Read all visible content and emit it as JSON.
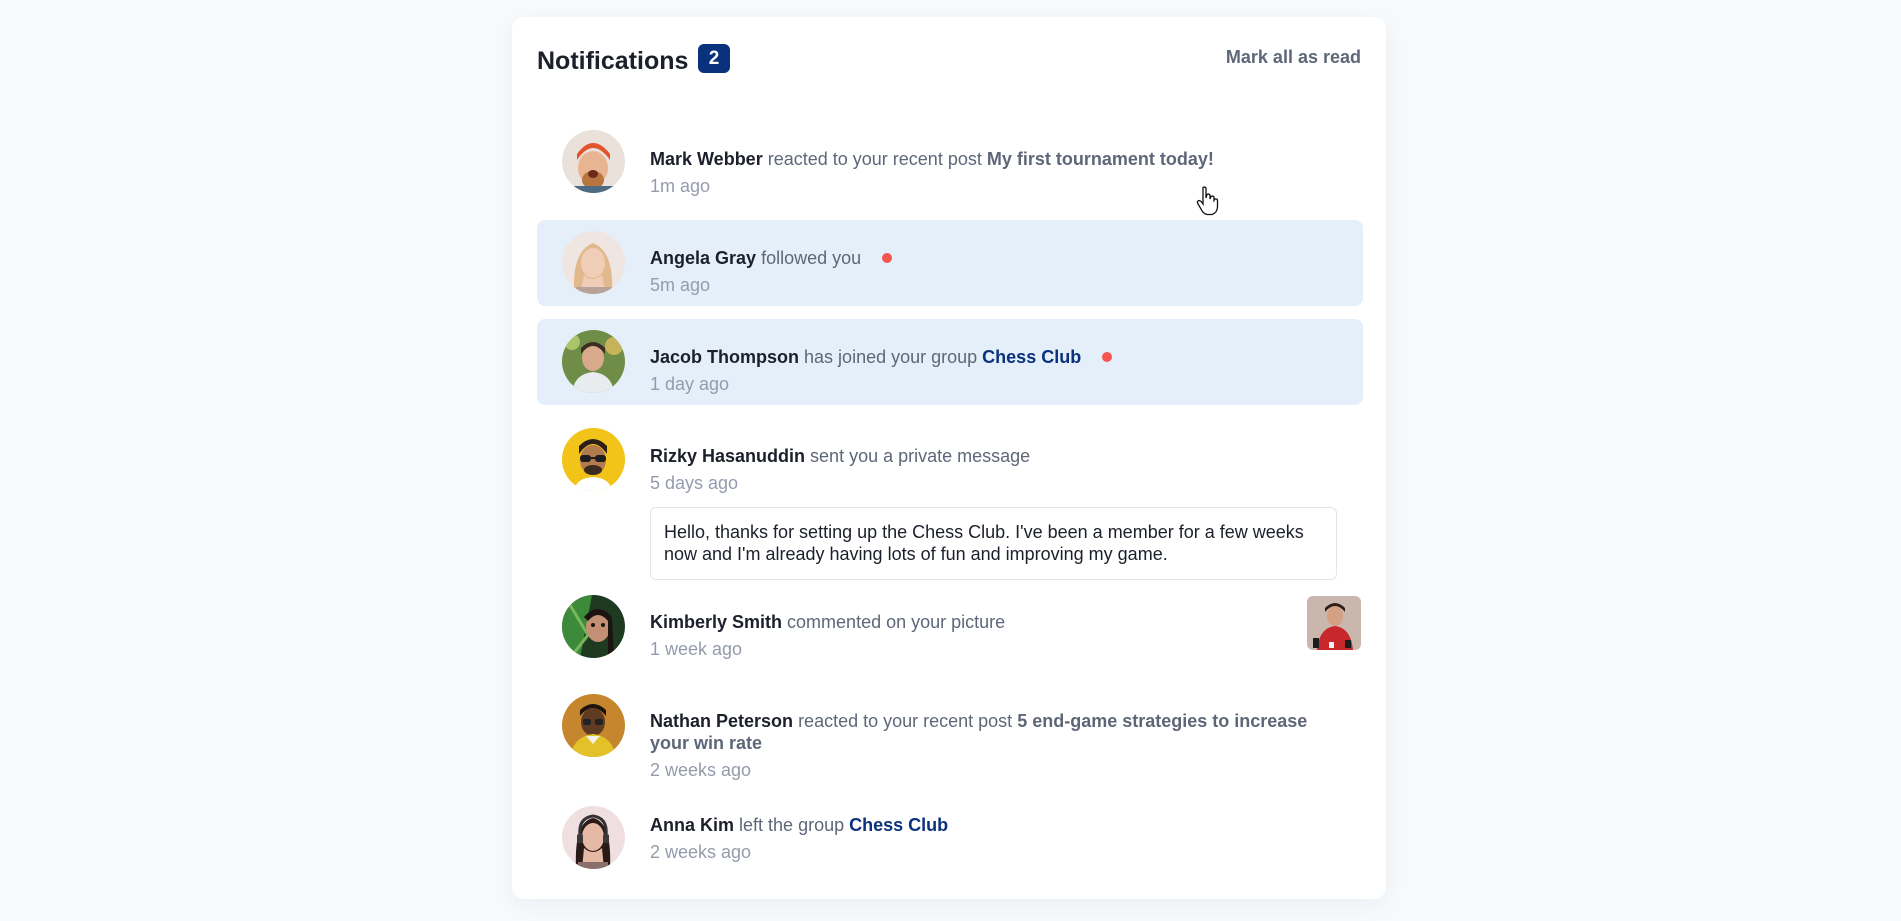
{
  "header": {
    "title": "Notifications",
    "unread_count": "2",
    "mark_all_label": "Mark all as read"
  },
  "notifications": [
    {
      "name": "Mark Webber",
      "action": "reacted to your recent post",
      "target": "My first tournament today!",
      "target_kind": "post",
      "time": "1m ago",
      "unread": false
    },
    {
      "name": "Angela Gray",
      "action": "followed you",
      "time": "5m ago",
      "unread": true
    },
    {
      "name": "Jacob Thompson",
      "action": "has joined your group",
      "target": "Chess Club",
      "target_kind": "group",
      "time": "1 day ago",
      "unread": true
    },
    {
      "name": "Rizky Hasanuddin",
      "action": "sent you a private message",
      "time": "5 days ago",
      "message": "Hello, thanks for setting up the Chess Club. I've been a member for a few weeks now and I'm already having lots of fun and improving my game.",
      "unread": false
    },
    {
      "name": "Kimberly Smith",
      "action": "commented on your picture",
      "time": "1 week ago",
      "unread": false
    },
    {
      "name": "Nathan Peterson",
      "action": "reacted to your recent post",
      "target": "5 end-game strategies to increase your win rate",
      "target_kind": "post",
      "time": "2 weeks ago",
      "unread": false
    },
    {
      "name": "Anna Kim",
      "action": "left the group",
      "target": "Chess Club",
      "target_kind": "group",
      "time": "2 weeks ago",
      "unread": false
    }
  ],
  "colors": {
    "unread_bg": "#e5effa",
    "badge": "#0a317b",
    "dot": "#f65552",
    "group_link": "#0a317b",
    "muted": "#939cad"
  }
}
